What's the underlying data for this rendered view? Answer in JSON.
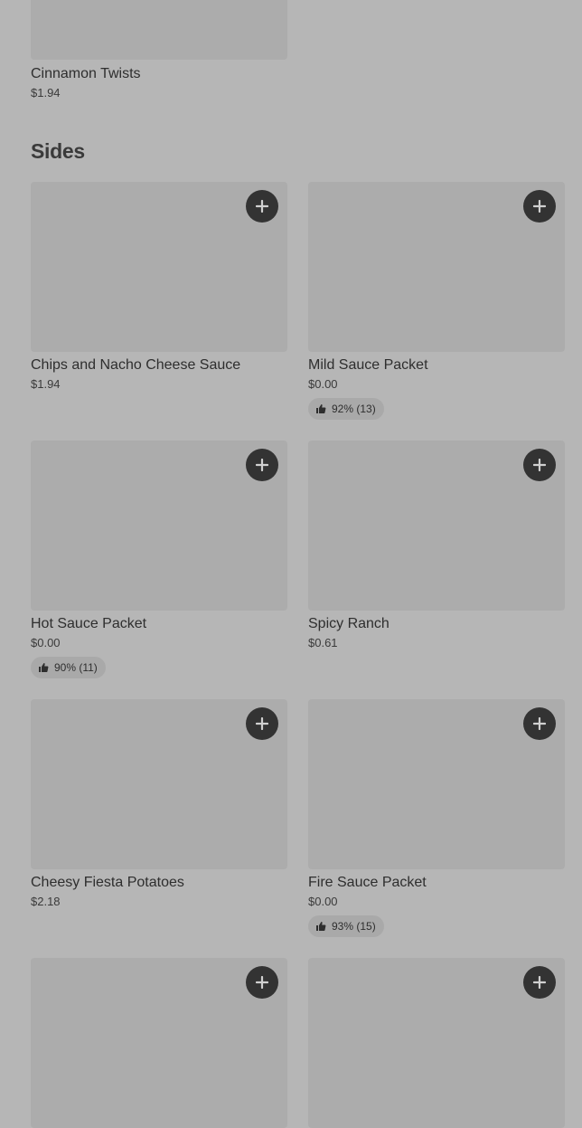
{
  "top_item": {
    "name": "Cinnamon Twists",
    "price": "$1.94"
  },
  "section": {
    "title": "Sides"
  },
  "items": [
    {
      "name": "Chips and Nacho Cheese Sauce",
      "price": "$1.94",
      "rating": ""
    },
    {
      "name": "Mild Sauce Packet",
      "price": "$0.00",
      "rating": "92% (13)"
    },
    {
      "name": "Hot Sauce Packet",
      "price": "$0.00",
      "rating": "90% (11)"
    },
    {
      "name": "Spicy Ranch",
      "price": "$0.61",
      "rating": ""
    },
    {
      "name": "Cheesy Fiesta Potatoes",
      "price": "$2.18",
      "rating": ""
    },
    {
      "name": "Fire Sauce Packet",
      "price": "$0.00",
      "rating": "93% (15)"
    },
    {
      "name": "",
      "price": "",
      "rating": ""
    },
    {
      "name": "",
      "price": "",
      "rating": ""
    }
  ],
  "icons": {
    "add": "plus-icon",
    "rating": "thumbs-up-icon"
  },
  "colors": {
    "background": "#b6b6b6",
    "image_placeholder": "#acacac",
    "add_button": "#333333"
  }
}
